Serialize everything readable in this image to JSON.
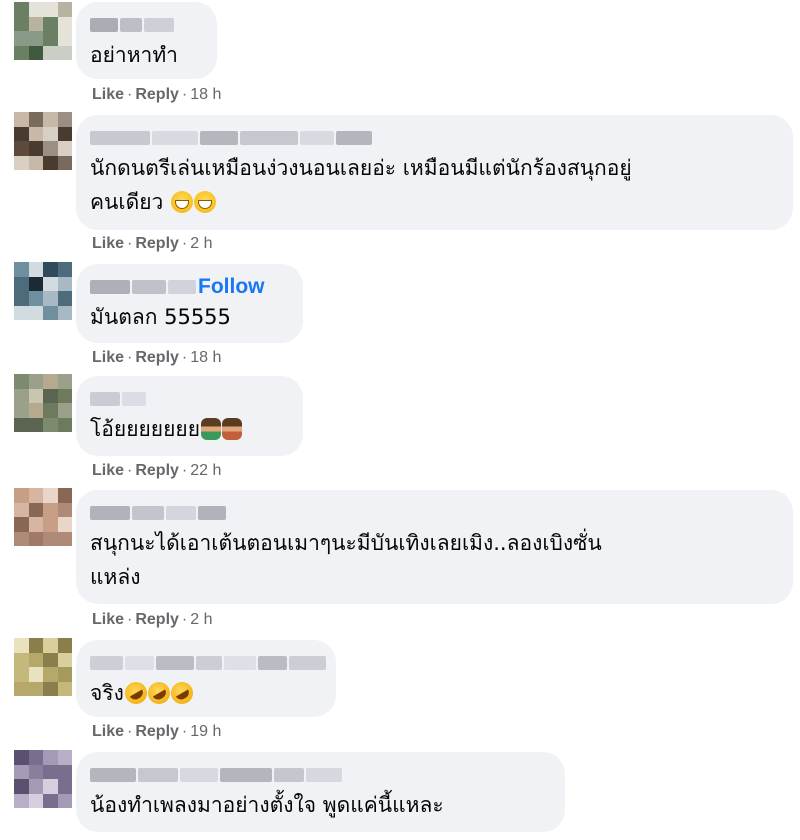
{
  "comments": [
    {
      "text": "อย่าหาทำ",
      "like": "Like",
      "reply": "Reply",
      "time": "18 h",
      "follow": "",
      "emojis": []
    },
    {
      "text": "นักดนตรีเล่นเหมือนง่วงนอนเลยอ่ะ เหมือนมีแต่นักร้องสนุกอยู่\nคนเดียว",
      "like": "Like",
      "reply": "Reply",
      "time": "2 h",
      "follow": "",
      "emojis": [
        "grinning-squinting-face",
        "grinning-squinting-face"
      ]
    },
    {
      "text": "มันตลก 55555",
      "like": "Like",
      "reply": "Reply",
      "time": "18 h",
      "follow": "Follow",
      "emojis": []
    },
    {
      "text": "โอ้ยยยยยยย",
      "like": "Like",
      "reply": "Reply",
      "time": "22 h",
      "follow": "",
      "emojis": [
        "person-facepalming",
        "person-facepalming"
      ]
    },
    {
      "text": "สนุกนะได้เอาเต้นตอนเมาๆนะมีบันเทิงเลยเมิง..ลองเบิงซั่น\nแหล่ง",
      "like": "Like",
      "reply": "Reply",
      "time": "2 h",
      "follow": "",
      "emojis": []
    },
    {
      "text": "จริง",
      "like": "Like",
      "reply": "Reply",
      "time": "19 h",
      "follow": "",
      "emojis": [
        "rolling-on-floor-laughing",
        "rolling-on-floor-laughing",
        "rolling-on-floor-laughing"
      ]
    },
    {
      "text": "น้องทำเพลงมาอย่างตั้งใจ พูดแค่นี้แหละ",
      "like": "",
      "reply": "",
      "time": "",
      "follow": "",
      "emojis": []
    }
  ]
}
